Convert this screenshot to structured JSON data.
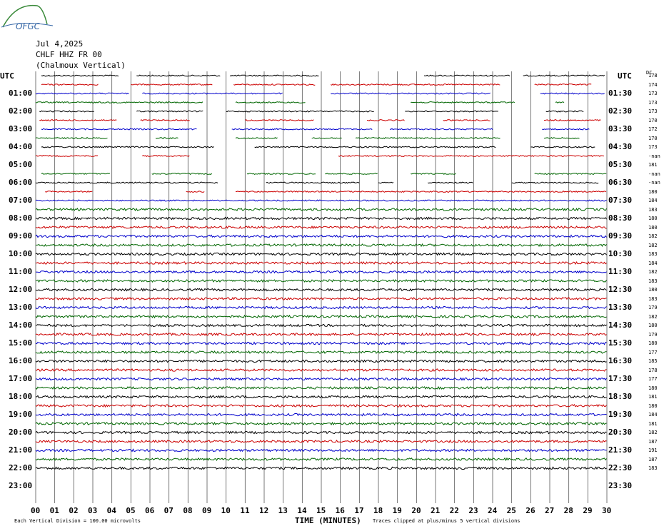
{
  "logo_text": "OFGC",
  "header": {
    "date": "Jul 4,2025",
    "station": "CHLF HHZ FR 00",
    "name": "(Chalmoux Vertical)"
  },
  "utc_left": "UTC",
  "utc_right": "UTC",
  "dc_label": "DC",
  "footer": {
    "scale": "Each Vertical Division =  100.00 microvolts",
    "xlabel": "TIME (MINUTES)",
    "clip": "Traces clipped at plus/minus 5 vertical divisions"
  },
  "colors": {
    "black": "#000000",
    "red": "#cc0000",
    "blue": "#0000cc",
    "green": "#006600",
    "grid": "#555555"
  },
  "chart_data": {
    "type": "line",
    "title": "CHLF HHZ FR 00 (Chalmoux Vertical) Jul 4,2025",
    "xlabel": "TIME (MINUTES)",
    "xlim": [
      0,
      30
    ],
    "x_ticks": [
      "00",
      "01",
      "02",
      "03",
      "04",
      "05",
      "06",
      "07",
      "08",
      "09",
      "10",
      "11",
      "12",
      "13",
      "14",
      "15",
      "16",
      "17",
      "18",
      "19",
      "20",
      "21",
      "22",
      "23",
      "24",
      "25",
      "26",
      "27",
      "28",
      "29",
      "30"
    ],
    "left_hour_labels": [
      "01:00",
      "02:00",
      "03:00",
      "04:00",
      "05:00",
      "06:00",
      "07:00",
      "08:00",
      "09:00",
      "10:00",
      "11:00",
      "12:00",
      "13:00",
      "14:00",
      "15:00",
      "16:00",
      "17:00",
      "18:00",
      "19:00",
      "20:00",
      "21:00",
      "22:00",
      "23:00"
    ],
    "right_hour_labels": [
      "01:30",
      "02:30",
      "03:30",
      "04:30",
      "05:30",
      "06:30",
      "07:30",
      "08:30",
      "09:30",
      "10:30",
      "11:30",
      "12:30",
      "13:30",
      "14:30",
      "15:30",
      "16:30",
      "17:30",
      "18:30",
      "19:30",
      "20:30",
      "21:30",
      "22:30",
      "23:30"
    ],
    "trace_color_cycle": [
      "black",
      "red",
      "blue",
      "green"
    ],
    "dc_offsets": [
      "178",
      "174",
      "173",
      "173",
      "173",
      "170",
      "172",
      "170",
      "173",
      "-nan",
      "181",
      "-nan",
      "-nan",
      "180",
      "184",
      "183",
      "180",
      "180",
      "182",
      "182",
      "183",
      "184",
      "182",
      "183",
      "180",
      "183",
      "179",
      "182",
      "180",
      "179",
      "180",
      "177",
      "185",
      "178",
      "177",
      "180",
      "181",
      "180",
      "184",
      "181",
      "182",
      "187",
      "191",
      "187",
      "183"
    ],
    "segments": [
      [
        [
          0.3,
          4.4
        ],
        [
          5.3,
          9.7
        ],
        [
          10.2,
          14.9
        ],
        [
          20.4,
          24.9
        ],
        [
          25.6,
          29.9
        ]
      ],
      [
        [
          0.3,
          3.3
        ],
        [
          5.0,
          9.3
        ],
        [
          10.4,
          14.7
        ],
        [
          15.5,
          24.4
        ],
        [
          26.2,
          29.2
        ]
      ],
      [
        [
          0,
          4.9
        ],
        [
          5.6,
          13.0
        ],
        [
          15.5,
          23.9
        ],
        [
          26.5,
          29.9
        ]
      ],
      [
        [
          0,
          8.8
        ],
        [
          10.5,
          14.2
        ],
        [
          19.7,
          25.2
        ],
        [
          27.3,
          27.8
        ]
      ],
      [
        [
          0.2,
          3.1
        ],
        [
          5.3,
          8.8
        ],
        [
          10.0,
          17.8
        ],
        [
          19.4,
          24.3
        ],
        [
          26.8,
          28.8
        ]
      ],
      [
        [
          0.2,
          4.3
        ],
        [
          5.5,
          8.1
        ],
        [
          11.0,
          14.6
        ],
        [
          17.4,
          19.4
        ],
        [
          21.4,
          23.9
        ],
        [
          26.7,
          29.7
        ]
      ],
      [
        [
          0.3,
          8.5
        ],
        [
          10.3,
          17.7
        ],
        [
          18.6,
          24.0
        ],
        [
          26.6,
          29.1
        ]
      ],
      [
        [
          0,
          3.8
        ],
        [
          6.3,
          7.5
        ],
        [
          10.5,
          12.7
        ],
        [
          14.5,
          16.1
        ],
        [
          16.8,
          24.4
        ],
        [
          26.7,
          28.6
        ]
      ],
      [
        [
          0.3,
          9.4
        ],
        [
          11.5,
          24.2
        ],
        [
          26.0,
          29.4
        ]
      ],
      [
        [
          0,
          3.3
        ],
        [
          5.6,
          8.1
        ],
        [
          15.9,
          29.9
        ]
      ],
      [],
      [
        [
          0.3,
          3.9
        ],
        [
          6.1,
          9.3
        ],
        [
          11.1,
          14.7
        ],
        [
          15.2,
          18.0
        ],
        [
          19.7,
          22.1
        ],
        [
          26.2,
          30.0
        ]
      ],
      [
        [
          0,
          9.6
        ],
        [
          12.1,
          17.0
        ],
        [
          18.0,
          18.8
        ],
        [
          20.6,
          23.0
        ],
        [
          25.0,
          29.6
        ]
      ],
      [
        [
          0.5,
          3.0
        ],
        [
          7.9,
          8.9
        ],
        [
          10.5,
          30.0
        ]
      ]
    ]
  }
}
